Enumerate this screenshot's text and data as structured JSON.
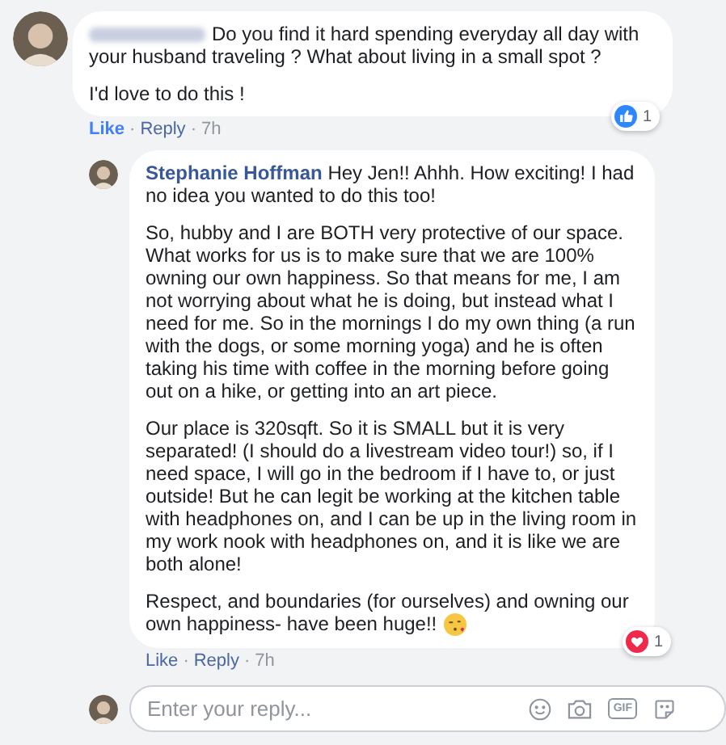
{
  "comments": [
    {
      "author_hidden": true,
      "paragraphs": [
        "Do you find it hard spending everyday all day with your husband traveling ? What about living in a small spot ?",
        "I'd love to do this !"
      ],
      "actions": {
        "like": "Like",
        "liked": true,
        "separator": "·",
        "reply": "Reply",
        "time": "7h"
      },
      "reaction": {
        "kind": "like",
        "count": "1"
      },
      "replies": [
        {
          "author": "Stephanie Hoffman",
          "paragraphs": [
            "Hey Jen!! Ahhh. How exciting! I had no idea you wanted to do this too!",
            "So, hubby and I are BOTH very protective of our space. What works for us is to make sure that we are 100% owning our own happiness. So that means for me, I am not worrying about what he is doing, but instead what I need for me. So in the mornings I do my own thing (a run with the dogs, or some morning yoga) and he is often taking his time with coffee in the morning before going out on a hike, or getting into an art piece.",
            "Our place is 320sqft. So it is SMALL but it is very separated! (I should do a livestream video tour!) so, if I need space, I will go in the bedroom if I have to, or just outside! But he can legit be working at the kitchen table with headphones on, and I can be up in the living room in my work nook with headphones on, and it is like we are both alone!",
            "Respect, and boundaries (for ourselves) and owning our own happiness- have been huge!!"
          ],
          "ends_with_emoji": true,
          "actions": {
            "like": "Like",
            "liked": false,
            "separator": "·",
            "reply": "Reply",
            "time": "7h"
          },
          "reaction": {
            "kind": "love",
            "count": "1"
          }
        }
      ]
    }
  ],
  "reply_box": {
    "placeholder": "Enter your reply...",
    "gif_label": "GIF"
  }
}
